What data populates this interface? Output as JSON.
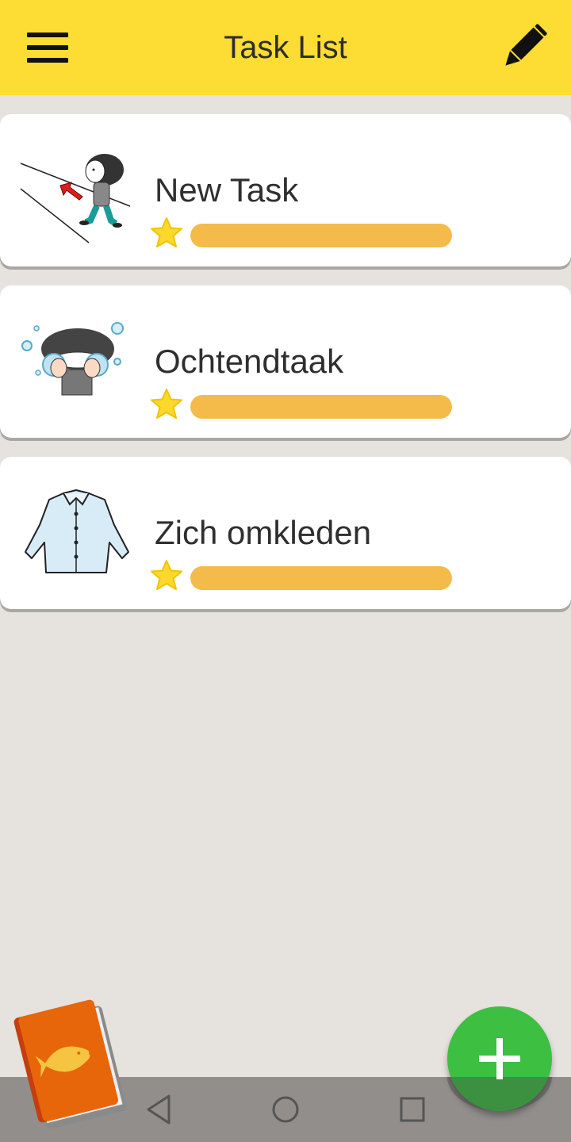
{
  "header": {
    "title": "Task List",
    "menu_icon": "hamburger-menu-icon",
    "edit_icon": "pencil-icon",
    "background_color": "#fddc34"
  },
  "tasks": [
    {
      "name": "New Task",
      "image": "person-walking-illustration",
      "rating_icon": "star-icon",
      "progress": 1.0
    },
    {
      "name": "Ochtendtaak",
      "image": "washing-face-illustration",
      "rating_icon": "star-icon",
      "progress": 1.0
    },
    {
      "name": "Zich omkleden",
      "image": "shirt-illustration",
      "rating_icon": "star-icon",
      "progress": 1.0
    }
  ],
  "fab": {
    "icon": "plus-icon",
    "color": "#3dbf42"
  },
  "bottom_left": {
    "icon": "fish-book-icon"
  },
  "system_nav": {
    "back_icon": "back-triangle-icon",
    "home_icon": "home-circle-icon",
    "recents_icon": "recents-square-icon"
  },
  "colors": {
    "progress": "#f4bb4a",
    "star": "#fcd82c",
    "background": "#e6e2de"
  }
}
